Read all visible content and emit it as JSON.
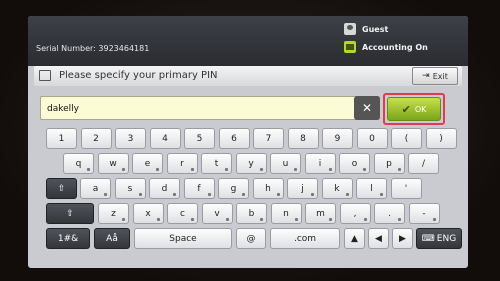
{
  "header": {
    "serial_text": "Serial Number: 3923464181",
    "user_label": "Guest",
    "accounting_label": "Accounting On"
  },
  "dialog": {
    "title": "Please specify your primary PIN",
    "exit_label": "Exit"
  },
  "pin_input": {
    "value": "dakelly"
  },
  "ok_label": "OK",
  "colors": {
    "ok_green": "#9bc32a",
    "highlight_red": "#e23a4e",
    "input_yellow": "#fbfbd6"
  },
  "keyboard": {
    "row1": [
      "1",
      "2",
      "3",
      "4",
      "5",
      "6",
      "7",
      "8",
      "9",
      "0",
      "(",
      ")"
    ],
    "row2": [
      "q",
      "w",
      "e",
      "r",
      "t",
      "y",
      "u",
      "i",
      "o",
      "p",
      "/"
    ],
    "row3": [
      "a",
      "s",
      "d",
      "f",
      "g",
      "h",
      "j",
      "k",
      "l",
      "'"
    ],
    "row4": [
      "z",
      "x",
      "c",
      "v",
      "b",
      "n",
      "m",
      ",",
      "."
    ],
    "symbols_label": "1#&",
    "alpha_label": "Aå",
    "space_label": "Space",
    "at_label": "@",
    "com_label": ".com",
    "lang_label": "ENG"
  }
}
